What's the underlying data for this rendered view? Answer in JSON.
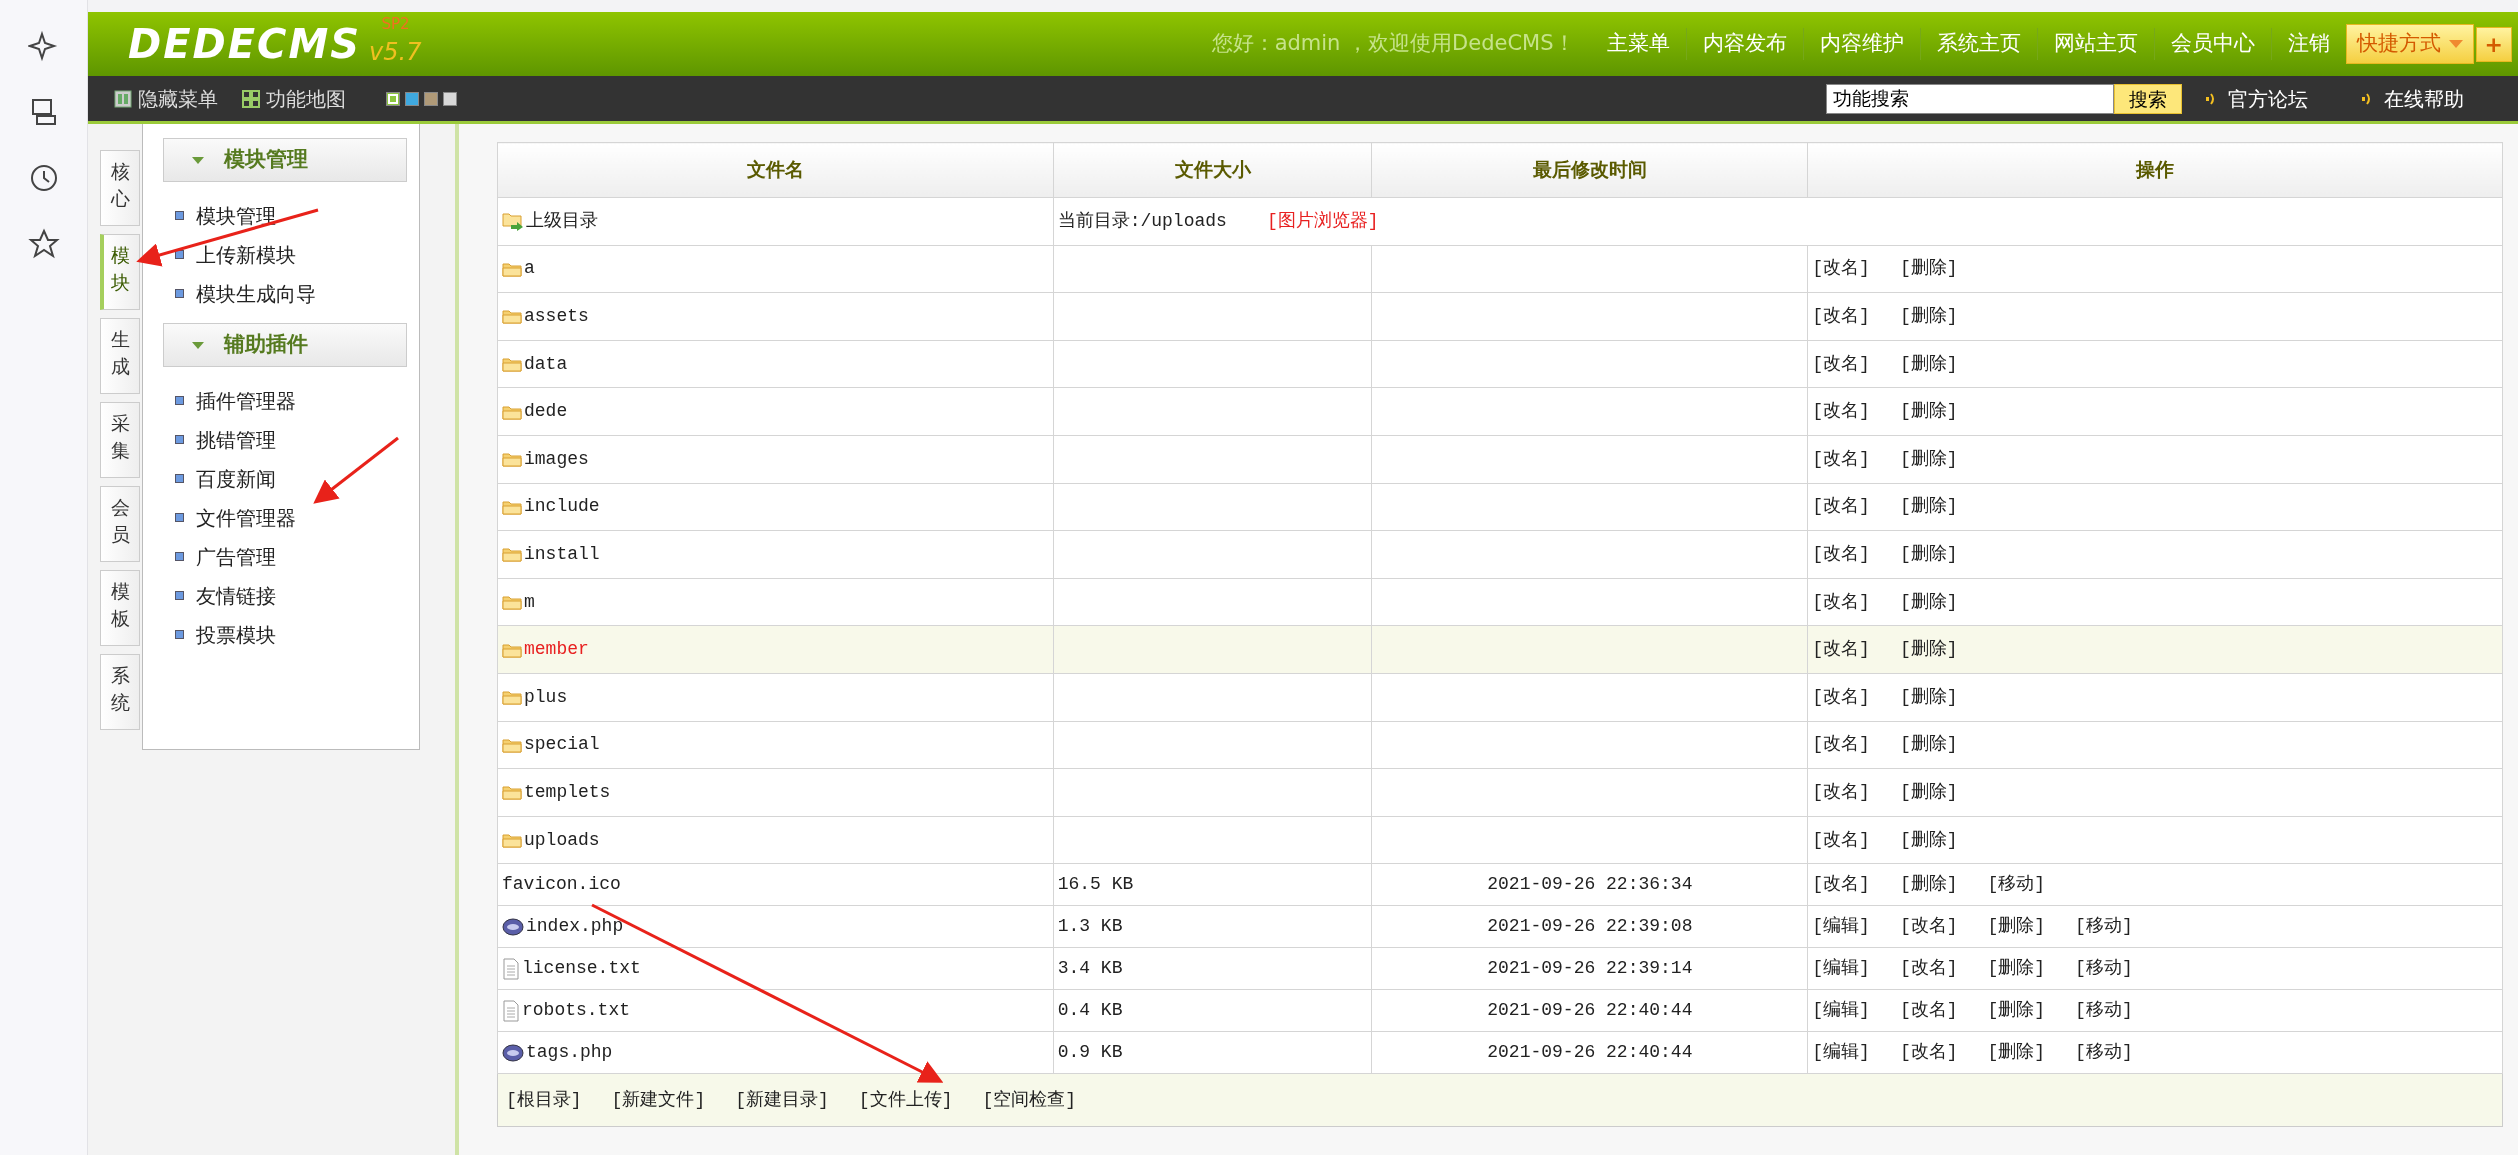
{
  "header": {
    "logo": "DEDECMS",
    "version": "v5.7",
    "edition": "SP2",
    "greeting": "您好：admin ，欢迎使用DedeCMS！",
    "nav": [
      "主菜单",
      "内容发布",
      "内容维护",
      "系统主页",
      "网站主页",
      "会员中心",
      "注销"
    ],
    "shortcut": "快捷方式",
    "shortcut_add": "+"
  },
  "toolbar": {
    "items": [
      {
        "label": "隐藏菜单",
        "kind": "hide"
      },
      {
        "label": "功能地图",
        "kind": "map"
      }
    ],
    "skins": [
      {
        "color": "#8cc63f",
        "selected": true
      },
      {
        "color": "#3fa9e0",
        "selected": false
      },
      {
        "color": "#b09a78",
        "selected": false
      },
      {
        "color": "#d8d8d8",
        "selected": false
      }
    ],
    "search": {
      "value": "功能搜索"
    },
    "search_button": "搜索",
    "links": [
      "官方论坛",
      "在线帮助"
    ]
  },
  "side_tabs": [
    {
      "label": "核心",
      "selected": false
    },
    {
      "label": "模块",
      "selected": true
    },
    {
      "label": "生成",
      "selected": false
    },
    {
      "label": "采集",
      "selected": false
    },
    {
      "label": "会员",
      "selected": false
    },
    {
      "label": "模板",
      "selected": false
    },
    {
      "label": "系统",
      "selected": false
    }
  ],
  "menu": [
    {
      "title": "模块管理",
      "items": [
        "模块管理",
        "上传新模块",
        "模块生成向导"
      ]
    },
    {
      "title": "辅助插件",
      "items": [
        "插件管理器",
        "挑错管理",
        "百度新闻",
        "文件管理器",
        "广告管理",
        "友情链接",
        "投票模块"
      ]
    }
  ],
  "table": {
    "columns": [
      "文件名",
      "文件大小",
      "最后修改时间",
      "操作"
    ],
    "parent": {
      "name": "上级目录",
      "current": "当前目录:/uploads",
      "link": "[图片浏览器]"
    },
    "rows": [
      {
        "kind": "folder",
        "name": "a",
        "highlighted": false,
        "actions": [
          "[改名]",
          "[删除]"
        ]
      },
      {
        "kind": "folder",
        "name": "assets",
        "highlighted": false,
        "actions": [
          "[改名]",
          "[删除]"
        ]
      },
      {
        "kind": "folder",
        "name": "data",
        "highlighted": false,
        "actions": [
          "[改名]",
          "[删除]"
        ]
      },
      {
        "kind": "folder",
        "name": "dede",
        "highlighted": false,
        "actions": [
          "[改名]",
          "[删除]"
        ]
      },
      {
        "kind": "folder",
        "name": "images",
        "highlighted": false,
        "actions": [
          "[改名]",
          "[删除]"
        ]
      },
      {
        "kind": "folder",
        "name": "include",
        "highlighted": false,
        "actions": [
          "[改名]",
          "[删除]"
        ]
      },
      {
        "kind": "folder",
        "name": "install",
        "highlighted": false,
        "actions": [
          "[改名]",
          "[删除]"
        ]
      },
      {
        "kind": "folder",
        "name": "m",
        "highlighted": false,
        "actions": [
          "[改名]",
          "[删除]"
        ]
      },
      {
        "kind": "folder",
        "name": "member",
        "highlighted": true,
        "actions": [
          "[改名]",
          "[删除]"
        ]
      },
      {
        "kind": "folder",
        "name": "plus",
        "highlighted": false,
        "actions": [
          "[改名]",
          "[删除]"
        ]
      },
      {
        "kind": "folder",
        "name": "special",
        "highlighted": false,
        "actions": [
          "[改名]",
          "[删除]"
        ]
      },
      {
        "kind": "folder",
        "name": "templets",
        "highlighted": false,
        "actions": [
          "[改名]",
          "[删除]"
        ]
      },
      {
        "kind": "folder",
        "name": "uploads",
        "highlighted": false,
        "actions": [
          "[改名]",
          "[删除]"
        ]
      },
      {
        "kind": "plain",
        "name": "favicon.ico",
        "size": "16.5 KB",
        "time": "2021-09-26 22:36:34",
        "highlighted": false,
        "actions": [
          "[改名]",
          "[删除]",
          "[移动]"
        ]
      },
      {
        "kind": "php",
        "name": "index.php",
        "size": "1.3 KB",
        "time": "2021-09-26 22:39:08",
        "highlighted": false,
        "actions": [
          "[编辑]",
          "[改名]",
          "[删除]",
          "[移动]"
        ]
      },
      {
        "kind": "text",
        "name": "license.txt",
        "size": "3.4 KB",
        "time": "2021-09-26 22:39:14",
        "highlighted": false,
        "actions": [
          "[编辑]",
          "[改名]",
          "[删除]",
          "[移动]"
        ]
      },
      {
        "kind": "text",
        "name": "robots.txt",
        "size": "0.4 KB",
        "time": "2021-09-26 22:40:44",
        "highlighted": false,
        "actions": [
          "[编辑]",
          "[改名]",
          "[删除]",
          "[移动]"
        ]
      },
      {
        "kind": "php",
        "name": "tags.php",
        "size": "0.9 KB",
        "time": "2021-09-26 22:40:44",
        "highlighted": false,
        "actions": [
          "[编辑]",
          "[改名]",
          "[删除]",
          "[移动]"
        ]
      }
    ],
    "footer": [
      "[根目录]",
      "[新建文件]",
      "[新建目录]",
      "[文件上传]",
      "[空间检查]"
    ]
  }
}
